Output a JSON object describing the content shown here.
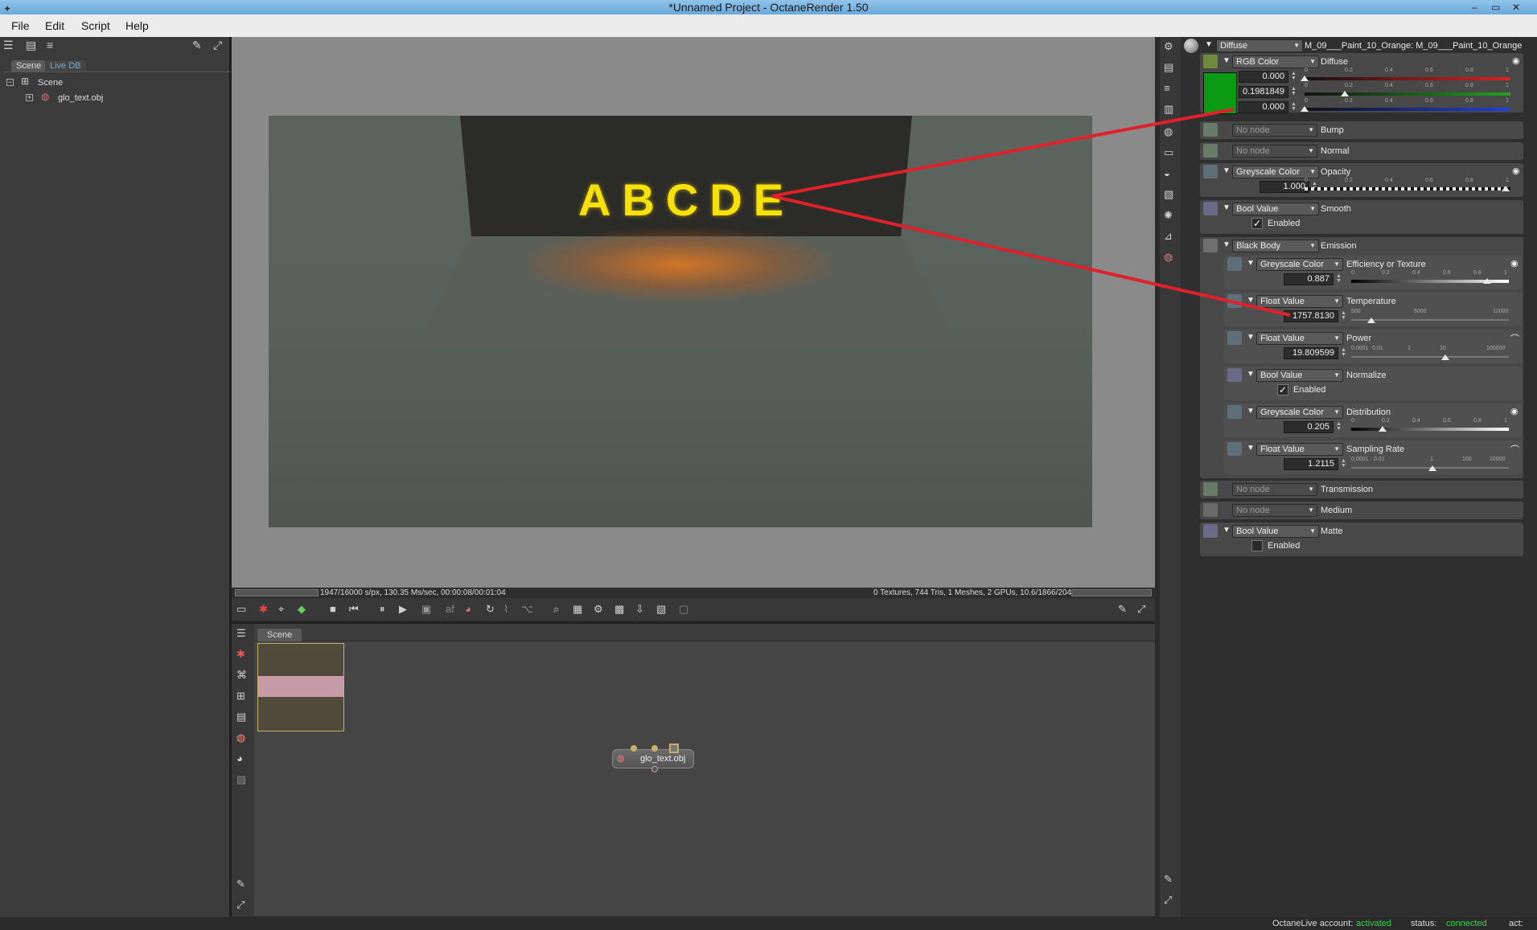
{
  "window": {
    "title": "*Unnamed Project - OctaneRender 1.50",
    "controls": [
      "–",
      "▭",
      "✕"
    ]
  },
  "menu": [
    "File",
    "Edit",
    "Script",
    "Help"
  ],
  "scene_panel": {
    "tabs": [
      "Scene",
      "Live DB"
    ],
    "tree": [
      {
        "label": "Scene",
        "expander": "−"
      },
      {
        "label": "glo_text.obj",
        "expander": "+"
      }
    ]
  },
  "render": {
    "scene_text": "ABCDE",
    "status_left": "1947/16000 s/px, 130.35 Ms/sec, 00:00:08/00:01:04",
    "status_right": "0 Textures, 744 Tris, 1 Meshes, 2 GPUs, 10.6/1866/2048 MB"
  },
  "nodegraph": {
    "tab": "Scene",
    "node_label": "glo_text.obj"
  },
  "inspector": {
    "material_type": "Diffuse",
    "material_name": "M_09___Paint_10_Orange:  M_09___Paint_10_Orange",
    "diffuse": {
      "node": "RGB Color",
      "label": "Diffuse",
      "swatch_color": "#0a9a14",
      "values": [
        "0.000",
        "0.1981849",
        "0.000"
      ],
      "ticks": [
        "0",
        "0.2",
        "0.4",
        "0.6",
        "0.8",
        "1"
      ],
      "channel_levels": [
        0.0,
        0.1981849,
        0.0
      ]
    },
    "bump": {
      "node": "No node",
      "label": "Bump"
    },
    "normal": {
      "node": "No node",
      "label": "Normal"
    },
    "opacity": {
      "node": "Greyscale Color",
      "label": "Opacity",
      "value": "1.000",
      "level": 1.0
    },
    "smooth": {
      "node": "Bool Value",
      "label": "Smooth",
      "check_label": "Enabled",
      "checked": true
    },
    "emission": {
      "node": "Black Body",
      "label": "Emission",
      "efficiency": {
        "node": "Greyscale Color",
        "label": "Efficiency or Texture",
        "value": "0.887",
        "level": 0.887
      },
      "temperature": {
        "node": "Float Value",
        "label": "Temperature",
        "value": "1757.8130",
        "ticks": [
          "500",
          "5000",
          "12000"
        ]
      },
      "power": {
        "node": "Float Value",
        "label": "Power",
        "value": "19.809599",
        "ticks": [
          "0.0001",
          "0.01",
          "1",
          "10",
          "100000"
        ]
      },
      "normalize": {
        "node": "Bool Value",
        "label": "Normalize",
        "check_label": "Enabled",
        "checked": true
      },
      "distribution": {
        "node": "Greyscale Color",
        "label": "Distribution",
        "value": "0.205",
        "level": 0.205
      },
      "sampling_rate": {
        "node": "Float Value",
        "label": "Sampling Rate",
        "value": "1.2115",
        "ticks": [
          "0.0001",
          "0.01",
          "1",
          "100",
          "10000"
        ]
      }
    },
    "transmission": {
      "node": "No node",
      "label": "Transmission"
    },
    "medium": {
      "node": "No node",
      "label": "Medium"
    },
    "matte": {
      "node": "Bool Value",
      "label": "Matte",
      "check_label": "Enabled",
      "checked": false
    }
  },
  "footer": {
    "account_label": "OctaneLive account:",
    "account_value": "activated",
    "status_label": "status:",
    "status_value": "connected",
    "act_label": "act:"
  },
  "colors": {
    "annotation_red": "#e0202a",
    "text_yellow": "#f6e20a",
    "ok_green": "#39d353"
  }
}
